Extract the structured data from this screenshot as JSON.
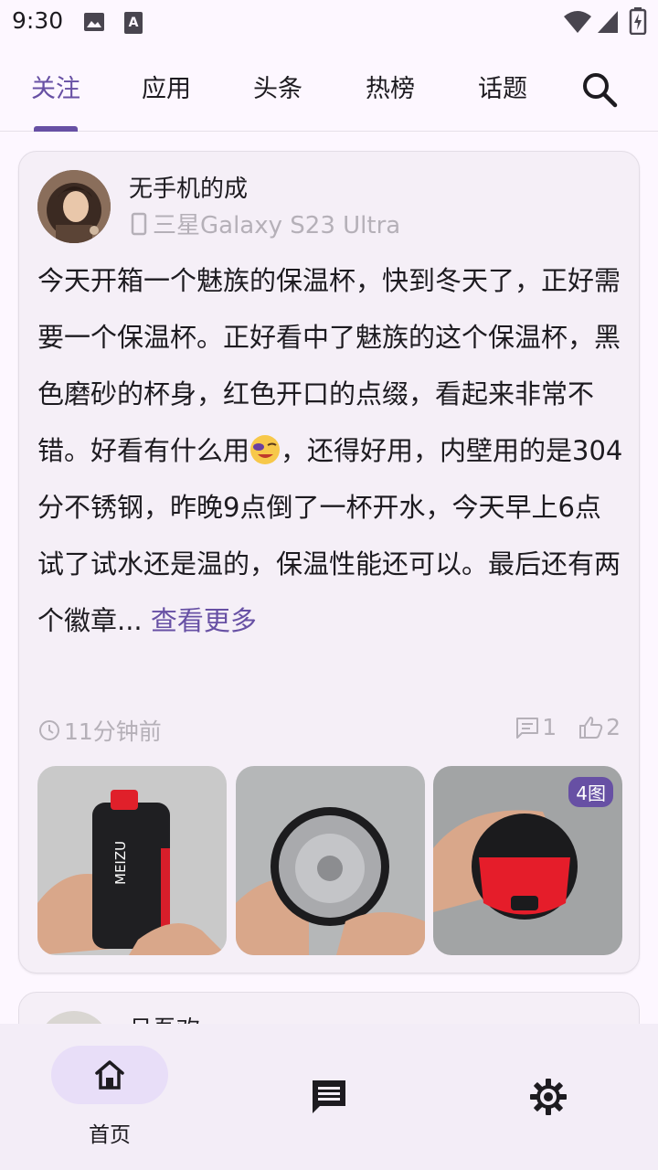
{
  "status_bar": {
    "time": "9:30"
  },
  "tabs": [
    {
      "label": "关注",
      "active": true
    },
    {
      "label": "应用",
      "active": false
    },
    {
      "label": "头条",
      "active": false
    },
    {
      "label": "热榜",
      "active": false
    },
    {
      "label": "话题",
      "active": false
    }
  ],
  "post": {
    "username": "无手机的成",
    "device": "三星Galaxy S23 Ultra",
    "text_part1": "今天开箱一个魅族的保温杯，快到冬天了，正好需要一个保温杯。正好看中了魅族的这个保温杯，黑色磨砂的杯身，红色开口的点缀，看起来非常不错。好看有什么用",
    "text_part2": "，还得好用，内壁用的是304分不锈钢，昨晚9点倒了一杯开水，今天早上6点试了试水还是温的，保温性能还可以。最后还有两个徽章... ",
    "more_label": "查看更多",
    "time": "11分钟前",
    "comments": "1",
    "likes": "2",
    "image_badge": "4图",
    "thumb1_brand": "MEIZU"
  },
  "next_post": {
    "username": "吕吾欢"
  },
  "bottom_nav": [
    {
      "label": "首页",
      "icon": "home-icon",
      "active": true
    },
    {
      "label": "",
      "icon": "message-icon",
      "active": false
    },
    {
      "label": "",
      "icon": "settings-icon",
      "active": false
    }
  ],
  "colors": {
    "accent": "#6750a4",
    "background": "#fdf7ff",
    "card": "#f5eff7",
    "muted": "#b5b0b8"
  }
}
